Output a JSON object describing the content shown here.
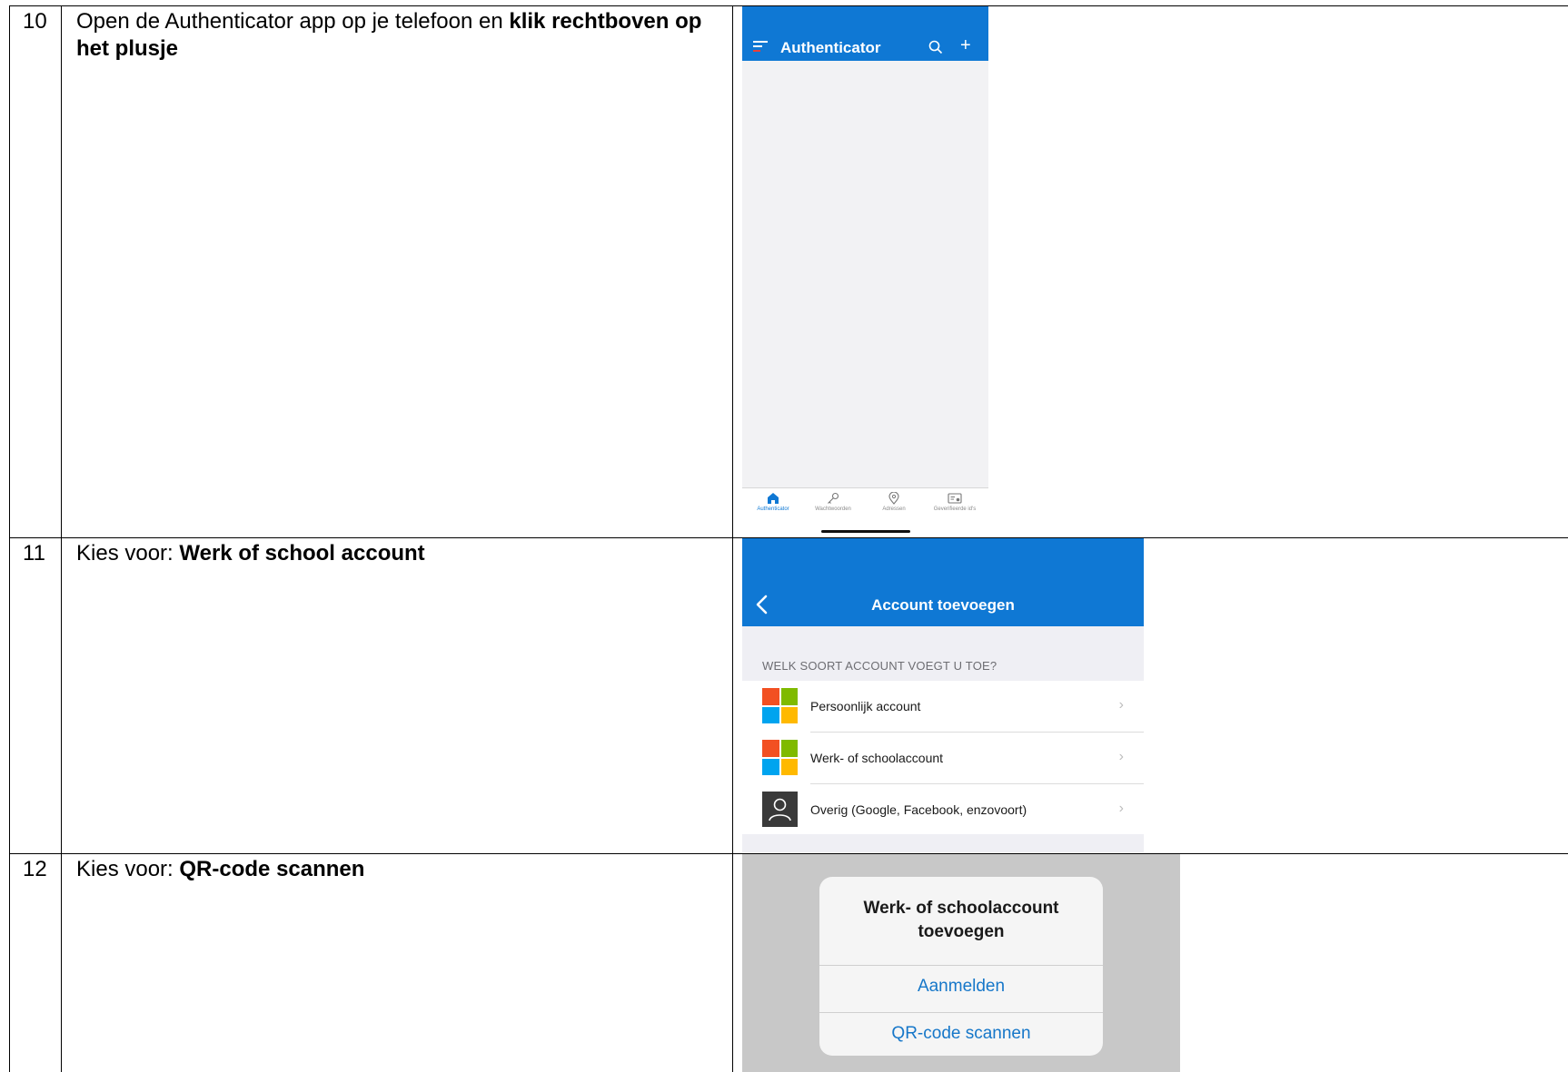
{
  "steps": [
    {
      "number": "10",
      "text_plain": "Open de Authenticator app op je telefoon en ",
      "text_bold": "klik rechtboven op het plusje"
    },
    {
      "number": "11",
      "text_plain": "Kies voor: ",
      "text_bold": "Werk of school account"
    },
    {
      "number": "12",
      "text_plain": "Kies voor: ",
      "text_bold": "QR-code scannen"
    }
  ],
  "screen_home": {
    "title": "Authenticator",
    "icons": [
      "menu-icon",
      "search-icon",
      "plus-icon"
    ],
    "plus_glyph": "+",
    "tabs": [
      {
        "label": "Authenticator",
        "icon": "home-icon",
        "active": true
      },
      {
        "label": "Wachtwoorden",
        "icon": "key-icon",
        "active": false
      },
      {
        "label": "Adressen",
        "icon": "location-pin-icon",
        "active": false
      },
      {
        "label": "Geverifieerde id's",
        "icon": "id-card-icon",
        "active": false
      }
    ],
    "accent_color": "#0f78d4"
  },
  "screen_add_account": {
    "title": "Account toevoegen",
    "section_header": "WELK SOORT ACCOUNT VOEGT U TOE?",
    "options": [
      {
        "label": "Persoonlijk account",
        "icon": "microsoft-logo-icon"
      },
      {
        "label": "Werk- of schoolaccount",
        "icon": "microsoft-logo-icon"
      },
      {
        "label": "Overig (Google, Facebook, enzovoort)",
        "icon": "person-icon"
      }
    ],
    "chevron_glyph": "›",
    "microsoft_colors": [
      "#f25022",
      "#7fba00",
      "#00a4ef",
      "#ffb900"
    ]
  },
  "screen_dialog": {
    "title_line1": "Werk- of schoolaccount",
    "title_line2": "toevoegen",
    "buttons": [
      "Aanmelden",
      "QR-code scannen"
    ],
    "button_color": "#1677c9"
  }
}
